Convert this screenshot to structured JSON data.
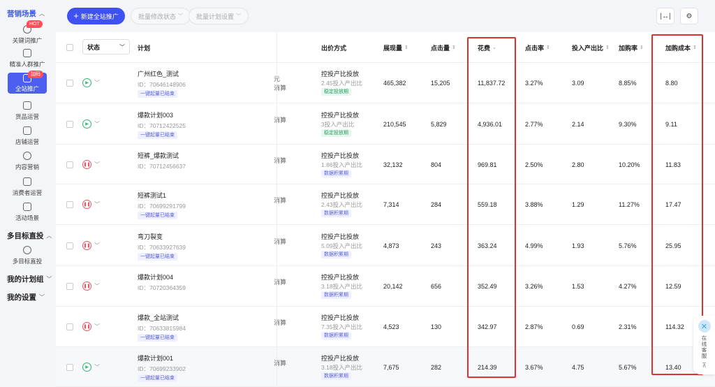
{
  "sidebar": {
    "group_marketing": "营销场景",
    "items": [
      {
        "label": "关键词推广",
        "icon": "target-icon",
        "badge": "HOT"
      },
      {
        "label": "精准人群推广",
        "icon": "crowd-icon"
      },
      {
        "label": "全站推广",
        "icon": "store-icon",
        "badge": "加码"
      },
      {
        "label": "货品运营",
        "icon": "goods-icon"
      },
      {
        "label": "店铺运营",
        "icon": "shop-icon"
      },
      {
        "label": "内容营销",
        "icon": "play-icon"
      },
      {
        "label": "消费者运营",
        "icon": "consumer-icon"
      },
      {
        "label": "活动场景",
        "icon": "activity-icon"
      }
    ],
    "group_multi": "多目标直投",
    "multi_item": "多目标直投",
    "group_plans": "我的计划组",
    "group_settings": "我的设置"
  },
  "toolbar": {
    "new_button": "新建全站推广",
    "batch_status": "批量修改状态",
    "batch_settings": "批量计划设置"
  },
  "table": {
    "headers": {
      "status": "状态",
      "plan": "计划",
      "bid": "出价方式",
      "impressions": "展现量",
      "clicks": "点击量",
      "cost": "花费",
      "ctr": "点击率",
      "roi": "投入产出比",
      "cart_rate": "加购率",
      "cart_cost": "加购成本"
    },
    "rows": [
      {
        "status": "on",
        "name": "广州红色_测试",
        "id": "ID：70646148906",
        "tag": "一键起量已结束",
        "frag": "元\n消算",
        "bid": "控投产比投放",
        "bid_sub": "2.45投入产出比",
        "bid_tag": "稳定投放期",
        "bid_tag_color": "green",
        "impressions": "465,382",
        "clicks": "15,205",
        "cost": "11,837.72",
        "ctr": "3.27%",
        "roi": "3.09",
        "cart_rate": "8.85%",
        "cart_cost": "8.80"
      },
      {
        "status": "on",
        "name": "爆款计划003",
        "id": "ID：70712422525",
        "tag": "一键起量已结束",
        "frag": "消算",
        "bid": "控投产比投放",
        "bid_sub": "3投入产出比",
        "bid_tag": "稳定投放期",
        "bid_tag_color": "green",
        "impressions": "210,545",
        "clicks": "5,829",
        "cost": "4,936.01",
        "ctr": "2.77%",
        "roi": "2.14",
        "cart_rate": "9.30%",
        "cart_cost": "9.11"
      },
      {
        "status": "off",
        "name": "短裤_爆款测试",
        "id": "ID：70712456637",
        "tag": "",
        "frag": "消算",
        "bid": "控投产比投放",
        "bid_sub": "1.86投入产出比",
        "bid_tag": "数据积累期",
        "bid_tag_color": "purple",
        "impressions": "32,132",
        "clicks": "804",
        "cost": "969.81",
        "ctr": "2.50%",
        "roi": "2.80",
        "cart_rate": "10.20%",
        "cart_cost": "11.83"
      },
      {
        "status": "off",
        "name": "短裤测试1",
        "id": "ID：70699291799",
        "tag": "一键起量已结束",
        "frag": "消算",
        "bid": "控投产比投放",
        "bid_sub": "2.43投入产出比",
        "bid_tag": "数据积累期",
        "bid_tag_color": "purple",
        "impressions": "7,314",
        "clicks": "284",
        "cost": "559.18",
        "ctr": "3.88%",
        "roi": "1.29",
        "cart_rate": "11.27%",
        "cart_cost": "17.47"
      },
      {
        "status": "off",
        "name": "弯刀裂变",
        "id": "ID：70633927639",
        "tag": "一键起量已结束",
        "frag": "消算",
        "bid": "控投产比投放",
        "bid_sub": "5.09投入产出比",
        "bid_tag": "数据积累期",
        "bid_tag_color": "purple",
        "impressions": "4,873",
        "clicks": "243",
        "cost": "363.24",
        "ctr": "4.99%",
        "roi": "1.93",
        "cart_rate": "5.76%",
        "cart_cost": "25.95"
      },
      {
        "status": "off",
        "name": "爆款计划004",
        "id": "ID：70720364359",
        "tag": "",
        "frag": "消算",
        "bid": "控投产比投放",
        "bid_sub": "3.18投入产出比",
        "bid_tag": "数据积累期",
        "bid_tag_color": "purple",
        "impressions": "20,142",
        "clicks": "656",
        "cost": "352.49",
        "ctr": "3.26%",
        "roi": "1.53",
        "cart_rate": "4.27%",
        "cart_cost": "12.59"
      },
      {
        "status": "off",
        "name": "爆款_全站测试",
        "id": "ID：70633815984",
        "tag": "一键起量已结束",
        "frag": "消算",
        "bid": "控投产比投放",
        "bid_sub": "7.35投入产出比",
        "bid_tag": "数据积累期",
        "bid_tag_color": "purple",
        "impressions": "4,523",
        "clicks": "130",
        "cost": "342.97",
        "ctr": "2.87%",
        "roi": "0.69",
        "cart_rate": "2.31%",
        "cart_cost": "114.32"
      },
      {
        "status": "on",
        "name": "爆款计划001",
        "id": "ID：70699233902",
        "tag": "一键起量已结束",
        "frag": "消算",
        "bid": "控投产比投放",
        "bid_sub": "3.18投入产出比",
        "bid_tag": "数据积累期",
        "bid_tag_color": "purple",
        "impressions": "7,675",
        "clicks": "282",
        "cost": "214.39",
        "ctr": "3.67%",
        "roi": "4.75",
        "cart_rate": "5.67%",
        "cart_cost": "13.40"
      }
    ]
  },
  "help": {
    "label": "在线客服"
  },
  "colors": {
    "accent": "#3f51f0",
    "highlight_box": "#e03030",
    "status_on": "#2eb872",
    "status_off": "#f2505f"
  }
}
